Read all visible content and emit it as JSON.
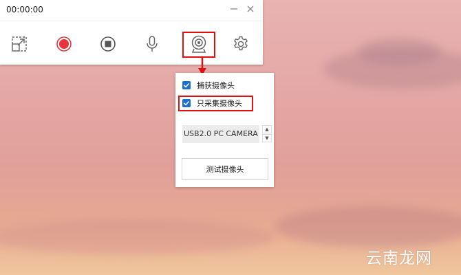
{
  "toolbar": {
    "timer": "00:00:00",
    "buttons": [
      {
        "name": "region-select",
        "icon": "resize-icon"
      },
      {
        "name": "record",
        "icon": "record-icon",
        "color": "#e8343c"
      },
      {
        "name": "stop",
        "icon": "stop-icon"
      },
      {
        "name": "microphone",
        "icon": "microphone-icon"
      },
      {
        "name": "webcam",
        "icon": "webcam-icon"
      },
      {
        "name": "settings",
        "icon": "gear-icon"
      }
    ]
  },
  "camera_panel": {
    "capture_camera": {
      "label": "捕获摄像头",
      "checked": true
    },
    "camera_only": {
      "label": "只采集摄像头",
      "checked": true
    },
    "device_value": "USB2.0 PC CAMERA",
    "test_button": "测试摄像头"
  },
  "watermark": "云南龙网",
  "colors": {
    "highlight": "#e01010",
    "checkbox": "#1b6fd1",
    "record": "#e8343c"
  }
}
